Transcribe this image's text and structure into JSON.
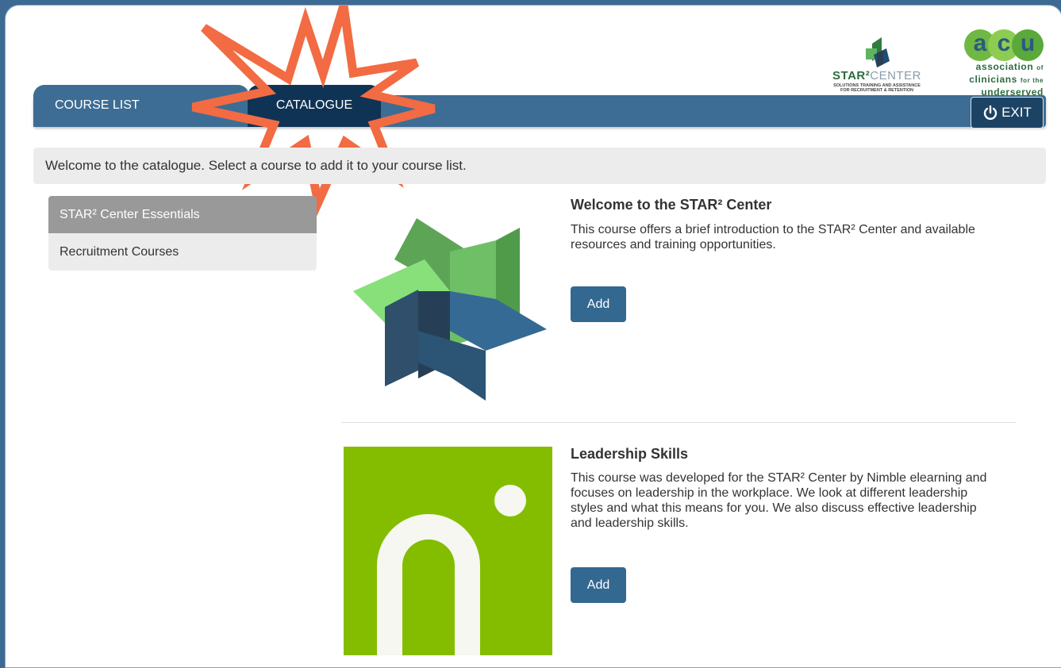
{
  "logos": {
    "star_bold": "STAR²",
    "star_light": "CENTER",
    "star_sub1": "SOLUTIONS TRAINING AND ASSISTANCE",
    "star_sub2": "FOR RECRUITMENT & RETENTION",
    "acu_a": "a",
    "acu_c": "c",
    "acu_u": "u",
    "acu_line1": "association",
    "acu_of": "of",
    "acu_line2": "clinicians",
    "acu_forthe": "for the",
    "acu_line3": "underserved"
  },
  "nav": {
    "tab_course_list": "COURSE LIST",
    "tab_catalogue": "CATALOGUE",
    "exit_label": "EXIT"
  },
  "welcome_text": "Welcome to the catalogue. Select a course to add it to your course list.",
  "sidebar": {
    "items": [
      {
        "label": "STAR² Center Essentials"
      },
      {
        "label": "Recruitment Courses"
      }
    ]
  },
  "courses": [
    {
      "title": "Welcome to the STAR² Center",
      "description": "This course offers a brief introduction to the STAR² Center and available resources and training opportunities.",
      "button": "Add"
    },
    {
      "title": "Leadership Skills",
      "description": "This course was developed for the STAR² Center by Nimble elearning and focuses on leadership in the workplace. We look at different leadership styles and what this means for you. We also discuss effective leadership and leadership skills.",
      "button": "Add"
    }
  ],
  "colors": {
    "brand_blue": "#3d6d94",
    "active_tab": "#0f3355",
    "burst": "#f26b43",
    "nimble_green": "#84bd00"
  }
}
